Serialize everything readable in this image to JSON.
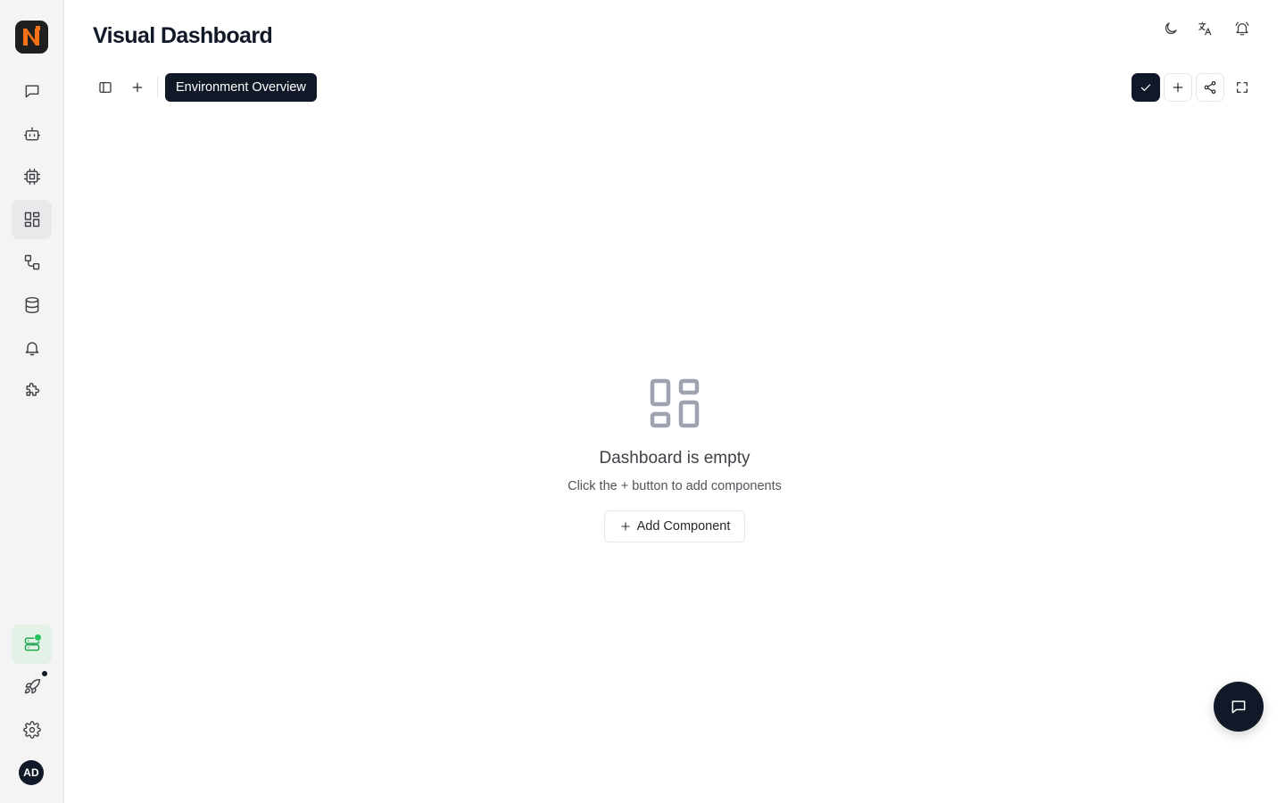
{
  "header": {
    "title": "Visual Dashboard",
    "actions": [
      {
        "icon": "moon-icon"
      },
      {
        "icon": "translate-icon"
      },
      {
        "icon": "bell-icon"
      }
    ]
  },
  "sidebar": {
    "logo_icon": "app-logo",
    "items": [
      {
        "icon": "chat-icon",
        "active": false
      },
      {
        "icon": "bot-icon",
        "active": false
      },
      {
        "icon": "cpu-icon",
        "active": false
      },
      {
        "icon": "dashboard-icon",
        "active": true
      },
      {
        "icon": "workflow-icon",
        "active": false
      },
      {
        "icon": "database-icon",
        "active": false
      },
      {
        "icon": "bell-icon",
        "active": false
      },
      {
        "icon": "puzzle-icon",
        "active": false
      }
    ],
    "bottom": [
      {
        "icon": "server-icon",
        "status_dot": "#22c55e"
      },
      {
        "icon": "rocket-icon",
        "status_dot": "#111827"
      },
      {
        "icon": "settings-icon"
      }
    ],
    "avatar_initials": "AD"
  },
  "toolbar": {
    "left_buttons": [
      {
        "icon": "sidebar-toggle-icon"
      },
      {
        "icon": "plus-icon"
      }
    ],
    "active_tab": "Environment Overview",
    "right_buttons": [
      {
        "icon": "check-icon",
        "variant": "dark"
      },
      {
        "icon": "plus-icon",
        "variant": "bordered"
      },
      {
        "icon": "share-icon",
        "variant": "bordered"
      },
      {
        "icon": "fullscreen-icon",
        "variant": "plain"
      }
    ]
  },
  "empty_state": {
    "icon": "dashboard-icon",
    "title": "Dashboard is empty",
    "subtitle": "Click the + button to add components",
    "button_label": "Add Component"
  },
  "chat_fab": {
    "icon": "chat-icon"
  },
  "colors": {
    "accent_dark": "#111827",
    "sidebar_bg": "#f4f4f5",
    "env_active_bg": "#e3f1e6",
    "status_green": "#22c55e",
    "logo_orange": "#f97316"
  }
}
